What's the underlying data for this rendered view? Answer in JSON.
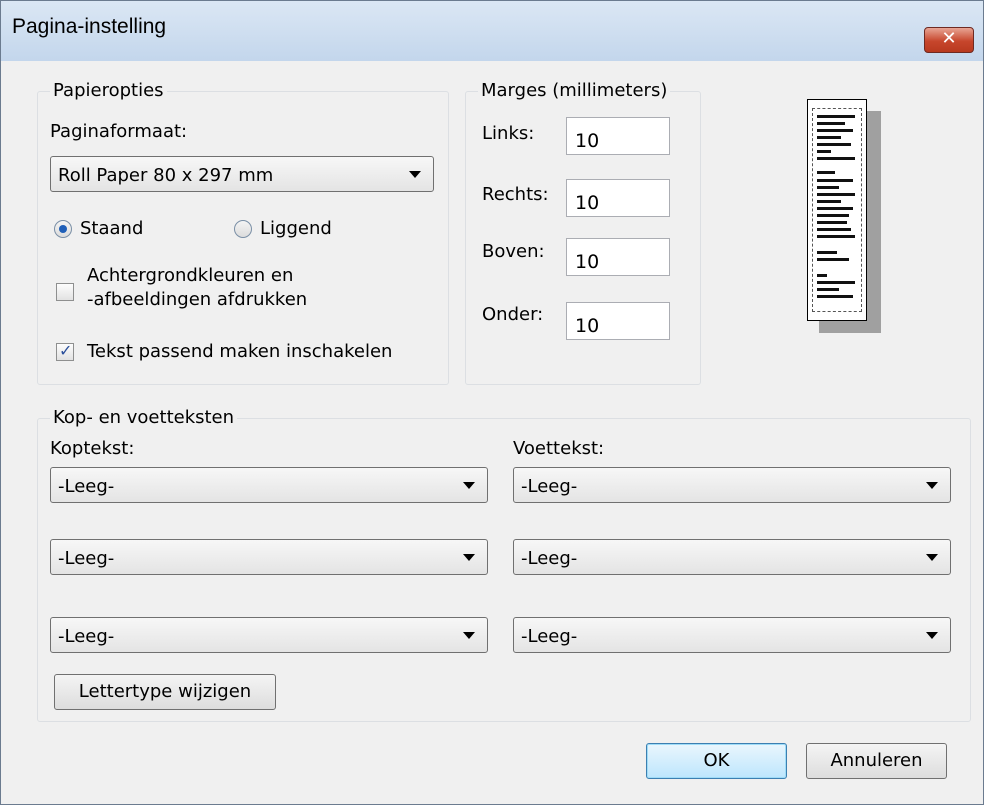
{
  "window": {
    "title": "Pagina-instelling",
    "close_glyph": "✕"
  },
  "paper": {
    "legend": "Papieropties",
    "size_label": "Paginaformaat:",
    "size_value": "Roll Paper 80 x 297 mm",
    "orientation": {
      "portrait": "Staand",
      "landscape": "Liggend",
      "selected": "Staand"
    },
    "background_label_line1": "Achtergrondkleuren en",
    "background_label_line2": "-afbeeldingen afdrukken",
    "background_checked": false,
    "shrink_label": "Tekst passend maken inschakelen",
    "shrink_checked": true
  },
  "margins": {
    "legend": "Marges (millimeters)",
    "left_label": "Links:",
    "left_value": "10",
    "right_label": "Rechts:",
    "right_value": "10",
    "top_label": "Boven:",
    "top_value": "10",
    "bottom_label": "Onder:",
    "bottom_value": "10"
  },
  "headers_footers": {
    "legend": "Kop- en voetteksten",
    "header_label": "Koptekst:",
    "footer_label": "Voettekst:",
    "header_values": [
      "-Leeg-",
      "-Leeg-",
      "-Leeg-"
    ],
    "footer_values": [
      "-Leeg-",
      "-Leeg-",
      "-Leeg-"
    ],
    "font_button": "Lettertype wijzigen"
  },
  "buttons": {
    "ok": "OK",
    "cancel": "Annuleren"
  }
}
